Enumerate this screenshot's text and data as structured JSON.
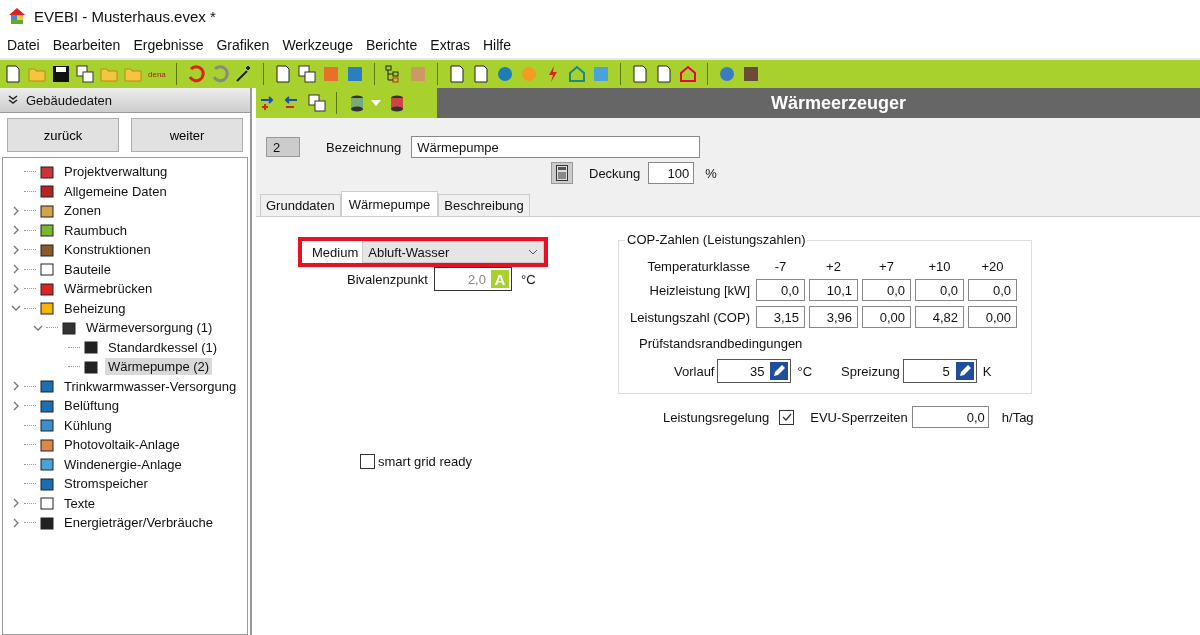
{
  "window": {
    "title": "EVEBI - Musterhaus.evex *"
  },
  "menu": [
    "Datei",
    "Bearbeiten",
    "Ergebnisse",
    "Grafiken",
    "Werkzeuge",
    "Berichte",
    "Extras",
    "Hilfe"
  ],
  "toolbar": {
    "dena_label": "dena"
  },
  "sidebar": {
    "title": "Gebäudedaten",
    "buttons": [
      "zurück",
      "weiter"
    ],
    "tree": [
      {
        "label": "Projektverwaltung",
        "kind": "leaf",
        "selected": false
      },
      {
        "label": "Allgemeine Daten",
        "kind": "leaf",
        "selected": false
      },
      {
        "label": "Zonen",
        "kind": "group",
        "expanded": false,
        "selected": false
      },
      {
        "label": "Raumbuch",
        "kind": "group",
        "expanded": false,
        "selected": false
      },
      {
        "label": "Konstruktionen",
        "kind": "group",
        "expanded": false,
        "selected": false
      },
      {
        "label": "Bauteile",
        "kind": "group",
        "expanded": false,
        "selected": false
      },
      {
        "label": "Wärmebrücken",
        "kind": "group",
        "expanded": false,
        "selected": false
      },
      {
        "label": "Beheizung",
        "kind": "group",
        "expanded": true,
        "selected": false,
        "children": [
          {
            "label": "Wärmeversorgung (1)",
            "kind": "group",
            "expanded": true,
            "selected": false,
            "children": [
              {
                "label": "Standardkessel (1)",
                "kind": "leaf",
                "selected": false
              },
              {
                "label": "Wärmepumpe (2)",
                "kind": "leaf",
                "selected": true
              }
            ]
          }
        ]
      },
      {
        "label": "Trinkwarmwasser-Versorgung",
        "kind": "group",
        "expanded": false,
        "selected": false
      },
      {
        "label": "Belüftung",
        "kind": "group",
        "expanded": false,
        "selected": false
      },
      {
        "label": "Kühlung",
        "kind": "leaf",
        "selected": false
      },
      {
        "label": "Photovoltaik-Anlage",
        "kind": "leaf",
        "selected": false
      },
      {
        "label": "Windenergie-Anlage",
        "kind": "leaf",
        "selected": false
      },
      {
        "label": "Stromspeicher",
        "kind": "leaf",
        "selected": false
      },
      {
        "label": "Texte",
        "kind": "group",
        "expanded": false,
        "selected": false
      },
      {
        "label": "Energieträger/Verbräuche",
        "kind": "group",
        "expanded": false,
        "selected": false
      }
    ]
  },
  "header": {
    "title": "Wärmeerzeuger"
  },
  "form": {
    "number": "2",
    "name_label": "Bezeichnung",
    "name_value": "Wärmepumpe",
    "coverage_label": "Deckung",
    "coverage_value": "100",
    "coverage_unit": "%"
  },
  "tabs": [
    {
      "label": "Grunddaten",
      "selected": false
    },
    {
      "label": "Wärmepumpe",
      "selected": true
    },
    {
      "label": "Beschreibung",
      "selected": false
    }
  ],
  "heatpump": {
    "medium_label": "Medium",
    "medium_value": "Abluft-Wasser",
    "medium_highlighted": true,
    "bivalence_label": "Bivalenzpunkt",
    "bivalence_value": "2,0",
    "bivalence_disabled": true,
    "bivalence_badge": "A",
    "bivalence_unit": "°C",
    "smart_grid": {
      "label": "smart grid ready",
      "checked": false
    },
    "cop": {
      "title": "COP-Zahlen (Leistungszahlen)",
      "class_label": "Temperaturklasse",
      "classes": [
        "-7",
        "+2",
        "+7",
        "+10",
        "+20"
      ],
      "rows": [
        {
          "label": "Heizleistung [kW]",
          "values": [
            "0,0",
            "10,1",
            "0,0",
            "0,0",
            "0,0"
          ]
        },
        {
          "label": "Leistungszahl (COP)",
          "values": [
            "3,15",
            "3,96",
            "0,00",
            "4,82",
            "0,00"
          ]
        }
      ],
      "test_title": "Prüfstandsrandbedingungen",
      "flow_label": "Vorlauf",
      "flow_value": "35",
      "flow_unit": "°C",
      "spread_label": "Spreizung",
      "spread_value": "5",
      "spread_unit": "K"
    },
    "control": {
      "label": "Leistungsregelung",
      "checked": true
    },
    "evu_label": "EVU-Sperrzeiten",
    "evu_value": "0,0",
    "evu_unit": "h/Tag"
  }
}
